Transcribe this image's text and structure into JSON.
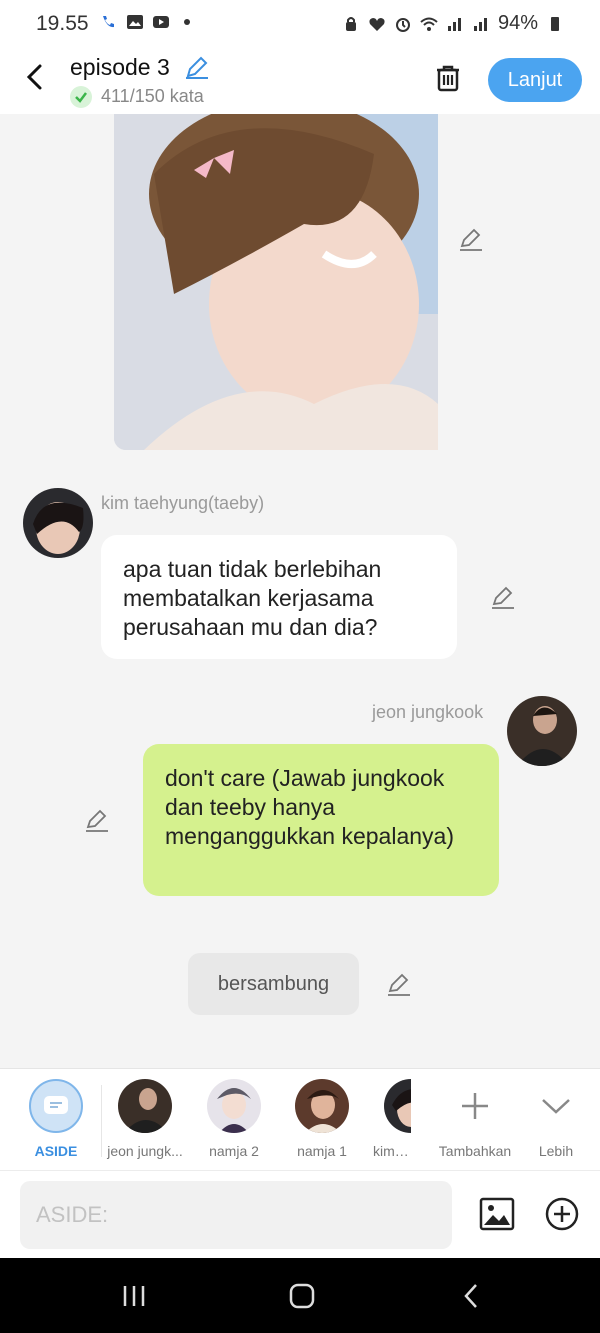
{
  "status_bar": {
    "time": "19.55",
    "battery": "94%"
  },
  "header": {
    "title": "episode 3",
    "word_count": "411/150 kata",
    "next_label": "Lanjut"
  },
  "messages": {
    "m1": {
      "sender": "kim taehyung(taeby)",
      "text": "apa tuan tidak berlebihan membatalkan kerjasama perusahaan mu dan dia?"
    },
    "m2": {
      "sender": "jeon jungkook",
      "text": "don't care (Jawab jungkook dan teeby hanya menganggukkan kepalanya)"
    },
    "aside": {
      "text": "bersambung"
    }
  },
  "characters": [
    {
      "label": "ASIDE"
    },
    {
      "label": "jeon jungk..."
    },
    {
      "label": "namja 2"
    },
    {
      "label": "namja 1"
    },
    {
      "label": "kim t..."
    },
    {
      "label": "Tambahkan"
    },
    {
      "label": "Lebih"
    }
  ],
  "input": {
    "placeholder": "ASIDE:"
  },
  "colors": {
    "accent": "#4ba4f0",
    "right_bubble": "#d5f18e"
  }
}
